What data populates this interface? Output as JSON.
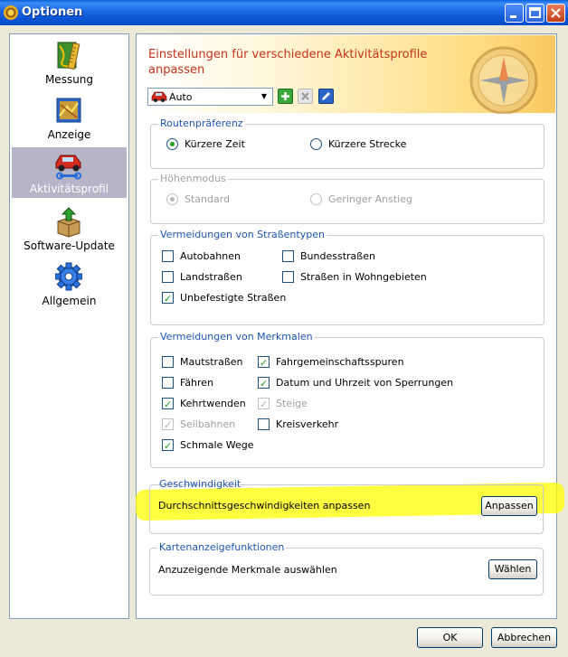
{
  "window": {
    "title": "Optionen"
  },
  "sidebar": {
    "items": [
      {
        "label": "Messung",
        "icon": "ruler-map-icon",
        "active": false
      },
      {
        "label": "Anzeige",
        "icon": "map-display-icon",
        "active": false
      },
      {
        "label": "Aktivitätsprofil",
        "icon": "car-profile-icon",
        "active": true
      },
      {
        "label": "Software-Update",
        "icon": "package-update-icon",
        "active": false
      },
      {
        "label": "Allgemein",
        "icon": "gear-icon",
        "active": false
      }
    ]
  },
  "banner": {
    "title": "Einstellungen für verschiedene Aktivitätsprofile anpassen"
  },
  "profile": {
    "selected": "Auto"
  },
  "route": {
    "title": "Routenpräferenz",
    "options": [
      {
        "label": "Kürzere Zeit",
        "checked": true
      },
      {
        "label": "Kürzere Strecke",
        "checked": false
      }
    ]
  },
  "height": {
    "title": "Höhenmodus",
    "options": [
      {
        "label": "Standard",
        "checked": true
      },
      {
        "label": "Geringer Anstieg",
        "checked": false
      }
    ]
  },
  "roads": {
    "title": "Vermeidungen von Straßentypen",
    "items": [
      {
        "label": "Autobahnen",
        "checked": false
      },
      {
        "label": "Bundesstraßen",
        "checked": false
      },
      {
        "label": "Landstraßen",
        "checked": false
      },
      {
        "label": "Straßen in Wohngebieten",
        "checked": false
      },
      {
        "label": "Unbefestigte Straßen",
        "checked": true
      }
    ]
  },
  "features": {
    "title": "Vermeidungen von Merkmalen",
    "items": [
      {
        "label": "Mautstraßen",
        "checked": false,
        "disabled": false
      },
      {
        "label": "Fahrgemeinschaftsspuren",
        "checked": true,
        "disabled": false
      },
      {
        "label": "Fähren",
        "checked": false,
        "disabled": false
      },
      {
        "label": "Datum und Uhrzeit von Sperrungen",
        "checked": true,
        "disabled": false
      },
      {
        "label": "Kehrtwenden",
        "checked": true,
        "disabled": false
      },
      {
        "label": "Steige",
        "checked": true,
        "disabled": true
      },
      {
        "label": "Seilbahnen",
        "checked": true,
        "disabled": true
      },
      {
        "label": "Kreisverkehr",
        "checked": false,
        "disabled": false
      },
      {
        "label": "Schmale Wege",
        "checked": true,
        "disabled": false
      }
    ]
  },
  "speed": {
    "title": "Geschwindigkeit",
    "text": "Durchschnittsgeschwindigkeiten anpassen",
    "button": "Anpassen"
  },
  "mapfeatures": {
    "title": "Kartenanzeigefunktionen",
    "text": "Anzuzeigende Merkmale auswählen",
    "button": "Wählen"
  },
  "footer": {
    "ok": "OK",
    "cancel": "Abbrechen"
  },
  "colors": {
    "accent": "#1d55b0",
    "banner_text": "#c8321a",
    "highlight": "#ffff00",
    "check": "#21a121"
  }
}
